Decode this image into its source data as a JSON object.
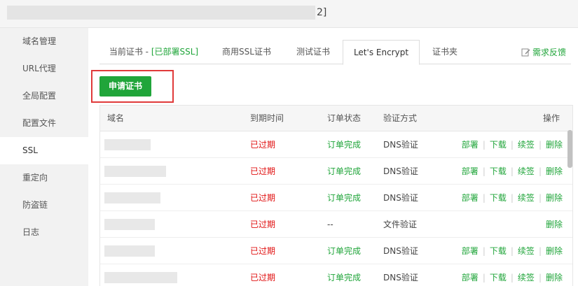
{
  "window": {
    "title_suffix": "2]"
  },
  "sidebar": {
    "items": [
      {
        "label": "域名管理"
      },
      {
        "label": "URL代理"
      },
      {
        "label": "全局配置"
      },
      {
        "label": "配置文件"
      },
      {
        "label": "SSL"
      },
      {
        "label": "重定向"
      },
      {
        "label": "防盗链"
      },
      {
        "label": "日志"
      }
    ],
    "active": "SSL"
  },
  "tabs": [
    {
      "label": "当前证书 - ",
      "extra": "[已部署SSL]"
    },
    {
      "label": "商用SSL证书"
    },
    {
      "label": "测试证书"
    },
    {
      "label": "Let's Encrypt"
    },
    {
      "label": "证书夹"
    }
  ],
  "active_tab": "Let's Encrypt",
  "feedback_label": "需求反馈",
  "apply_button": "申请证书",
  "table": {
    "headers": {
      "domain": "域名",
      "expiry": "到期时间",
      "status": "订单状态",
      "method": "验证方式",
      "actions": "操作"
    },
    "rows": [
      {
        "expiry": "已过期",
        "status": "订单完成",
        "method": "DNS验证",
        "actions": [
          "部署",
          "下载",
          "续签",
          "删除"
        ]
      },
      {
        "expiry": "已过期",
        "status": "订单完成",
        "method": "DNS验证",
        "actions": [
          "部署",
          "下载",
          "续签",
          "删除"
        ]
      },
      {
        "expiry": "已过期",
        "status": "订单完成",
        "method": "DNS验证",
        "actions": [
          "部署",
          "下载",
          "续签",
          "删除"
        ]
      },
      {
        "expiry": "已过期",
        "status": "--",
        "method": "文件验证",
        "actions": [
          "删除"
        ]
      },
      {
        "expiry": "已过期",
        "status": "订单完成",
        "method": "DNS验证",
        "actions": [
          "部署",
          "下载",
          "续签",
          "删除"
        ]
      },
      {
        "expiry": "已过期",
        "status": "订单完成",
        "method": "DNS验证",
        "actions": [
          "部署",
          "下载",
          "续签",
          "删除"
        ]
      }
    ]
  },
  "colors": {
    "accent": "#20a53a",
    "expired": "#e01010",
    "highlight_outline": "#e03a3a"
  }
}
